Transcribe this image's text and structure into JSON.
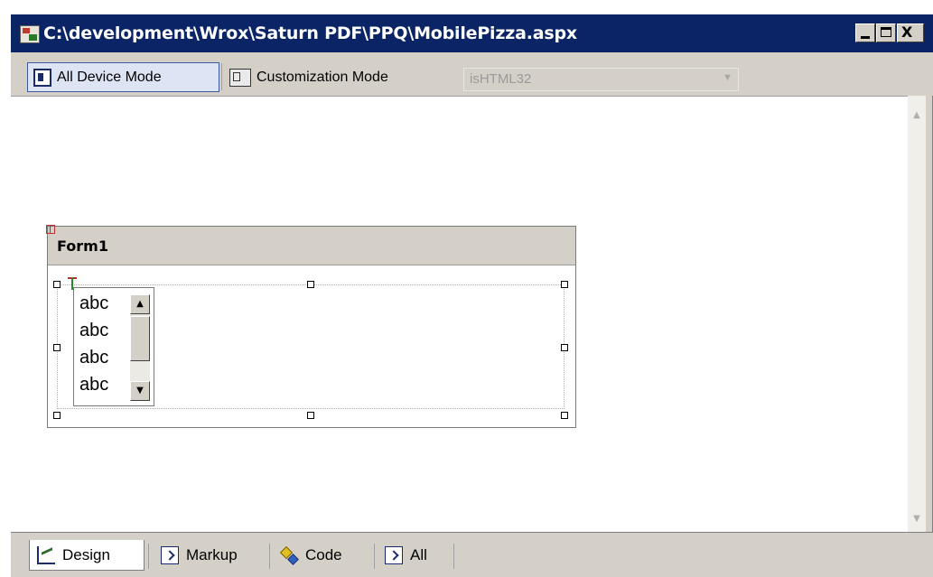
{
  "window": {
    "title": "C:\\development\\Wrox\\Saturn PDF\\PPQ\\MobilePizza.aspx",
    "close_glyph": "X"
  },
  "toolbar": {
    "all_device_mode_label": "All Device Mode",
    "customization_mode_label": "Customization Mode",
    "device_filter_value": "isHTML32"
  },
  "form": {
    "title": "Form1",
    "list_items": [
      "abc",
      "abc",
      "abc",
      "abc"
    ]
  },
  "tabs": [
    {
      "label": "Design",
      "icon": "design-icon",
      "active": true
    },
    {
      "label": "Markup",
      "icon": "markup-icon"
    },
    {
      "label": "Code",
      "icon": "code-icon"
    },
    {
      "label": "All",
      "icon": "all-icon"
    }
  ]
}
